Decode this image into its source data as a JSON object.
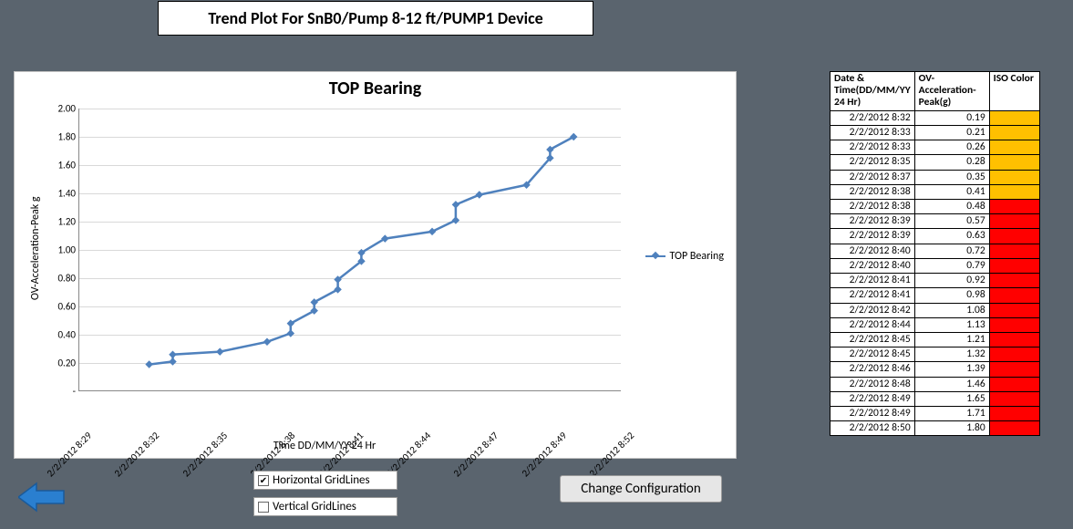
{
  "title": "Trend Plot For SnB0/Pump 8-12 ft/PUMP1 Device",
  "chart": {
    "title": "TOP Bearing",
    "yaxis_label": "OV-Acceleration-Peak  g",
    "xaxis_label": "Time   DD/MM/YY 24 Hr",
    "legend_label": "TOP Bearing",
    "xticks": [
      "2/2/2012 8:29",
      "2/2/2012 8:32",
      "2/2/2012 8:35",
      "2/2/2012 8:38",
      "2/2/2012 8:41",
      "2/2/2012 8:44",
      "2/2/2012 8:47",
      "2/2/2012 8:49",
      "2/2/2012 8:52"
    ],
    "yticks": [
      "-",
      "0.20",
      "0.40",
      "0.60",
      "0.80",
      "1.00",
      "1.20",
      "1.40",
      "1.60",
      "1.80",
      "2.00"
    ]
  },
  "controls": {
    "horizontal_label": "Horizontal GridLines",
    "vertical_label": "Vertical GridLines",
    "horizontal_checked": true,
    "vertical_checked": false
  },
  "config_button": "Change  Configuration",
  "table": {
    "headers": [
      "Date & Time(DD/MM/YY 24 Hr)",
      "OV-Acceleration-Peak(g)",
      "ISO Color"
    ],
    "rows": [
      {
        "dt": "2/2/2012 8:32",
        "val": "0.19",
        "color": "#ffc000"
      },
      {
        "dt": "2/2/2012 8:33",
        "val": "0.21",
        "color": "#ffc000"
      },
      {
        "dt": "2/2/2012 8:33",
        "val": "0.26",
        "color": "#ffc000"
      },
      {
        "dt": "2/2/2012 8:35",
        "val": "0.28",
        "color": "#ffc000"
      },
      {
        "dt": "2/2/2012 8:37",
        "val": "0.35",
        "color": "#ffc000"
      },
      {
        "dt": "2/2/2012 8:38",
        "val": "0.41",
        "color": "#ffc000"
      },
      {
        "dt": "2/2/2012 8:38",
        "val": "0.48",
        "color": "#ff0000"
      },
      {
        "dt": "2/2/2012 8:39",
        "val": "0.57",
        "color": "#ff0000"
      },
      {
        "dt": "2/2/2012 8:39",
        "val": "0.63",
        "color": "#ff0000"
      },
      {
        "dt": "2/2/2012 8:40",
        "val": "0.72",
        "color": "#ff0000"
      },
      {
        "dt": "2/2/2012 8:40",
        "val": "0.79",
        "color": "#ff0000"
      },
      {
        "dt": "2/2/2012 8:41",
        "val": "0.92",
        "color": "#ff0000"
      },
      {
        "dt": "2/2/2012 8:41",
        "val": "0.98",
        "color": "#ff0000"
      },
      {
        "dt": "2/2/2012 8:42",
        "val": "1.08",
        "color": "#ff0000"
      },
      {
        "dt": "2/2/2012 8:44",
        "val": "1.13",
        "color": "#ff0000"
      },
      {
        "dt": "2/2/2012 8:45",
        "val": "1.21",
        "color": "#ff0000"
      },
      {
        "dt": "2/2/2012 8:45",
        "val": "1.32",
        "color": "#ff0000"
      },
      {
        "dt": "2/2/2012 8:46",
        "val": "1.39",
        "color": "#ff0000"
      },
      {
        "dt": "2/2/2012 8:48",
        "val": "1.46",
        "color": "#ff0000"
      },
      {
        "dt": "2/2/2012 8:49",
        "val": "1.65",
        "color": "#ff0000"
      },
      {
        "dt": "2/2/2012 8:49",
        "val": "1.71",
        "color": "#ff0000"
      },
      {
        "dt": "2/2/2012 8:50",
        "val": "1.80",
        "color": "#ff0000"
      }
    ]
  },
  "chart_data": {
    "type": "line",
    "title": "TOP Bearing",
    "xlabel": "Time DD/MM/YY 24 Hr",
    "ylabel": "OV-Acceleration-Peak g",
    "ylim": [
      0,
      2.0
    ],
    "xlim_labels": [
      "2/2/2012 8:29",
      "2/2/2012 8:52"
    ],
    "series": [
      {
        "name": "TOP Bearing",
        "color": "#4f81bd",
        "x": [
          "2/2/2012 8:32",
          "2/2/2012 8:33",
          "2/2/2012 8:33",
          "2/2/2012 8:35",
          "2/2/2012 8:37",
          "2/2/2012 8:38",
          "2/2/2012 8:38",
          "2/2/2012 8:39",
          "2/2/2012 8:39",
          "2/2/2012 8:40",
          "2/2/2012 8:40",
          "2/2/2012 8:41",
          "2/2/2012 8:41",
          "2/2/2012 8:42",
          "2/2/2012 8:44",
          "2/2/2012 8:45",
          "2/2/2012 8:45",
          "2/2/2012 8:46",
          "2/2/2012 8:48",
          "2/2/2012 8:49",
          "2/2/2012 8:49",
          "2/2/2012 8:50"
        ],
        "y": [
          0.19,
          0.21,
          0.26,
          0.28,
          0.35,
          0.41,
          0.48,
          0.57,
          0.63,
          0.72,
          0.79,
          0.92,
          0.98,
          1.08,
          1.13,
          1.21,
          1.32,
          1.39,
          1.46,
          1.65,
          1.71,
          1.8
        ]
      }
    ]
  }
}
